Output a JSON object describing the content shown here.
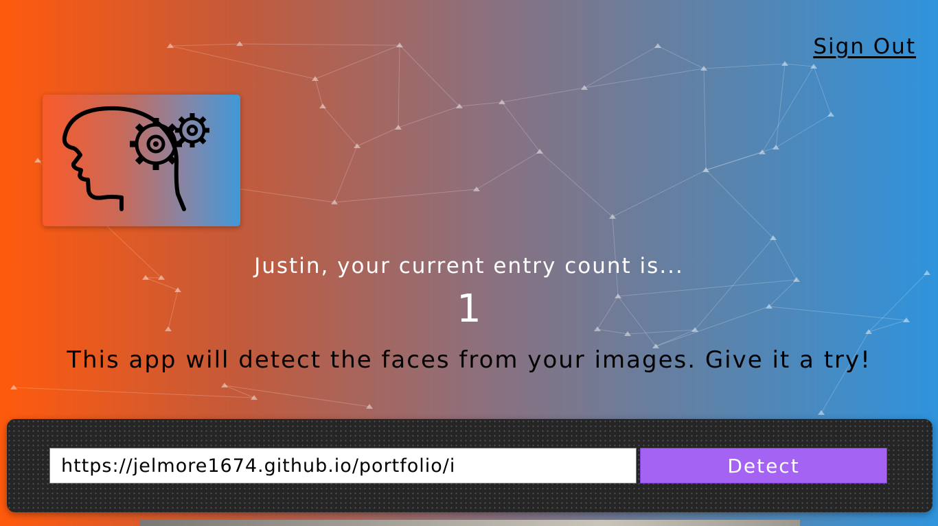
{
  "nav": {
    "signout_label": "Sign Out"
  },
  "logo": {
    "icon": "brain-gears-icon"
  },
  "rank": {
    "message": "Justin, your current entry count is...",
    "count": "1"
  },
  "intro": {
    "text": "This app will detect the faces from your images. Give it a try!"
  },
  "form": {
    "url_value": "https://jelmore1674.github.io/portfolio/i",
    "detect_label": "Detect"
  },
  "colors": {
    "gradient_left": "#ff5a0d",
    "gradient_right": "#2f93dc",
    "button": "#a463f2",
    "panel": "#252525"
  }
}
